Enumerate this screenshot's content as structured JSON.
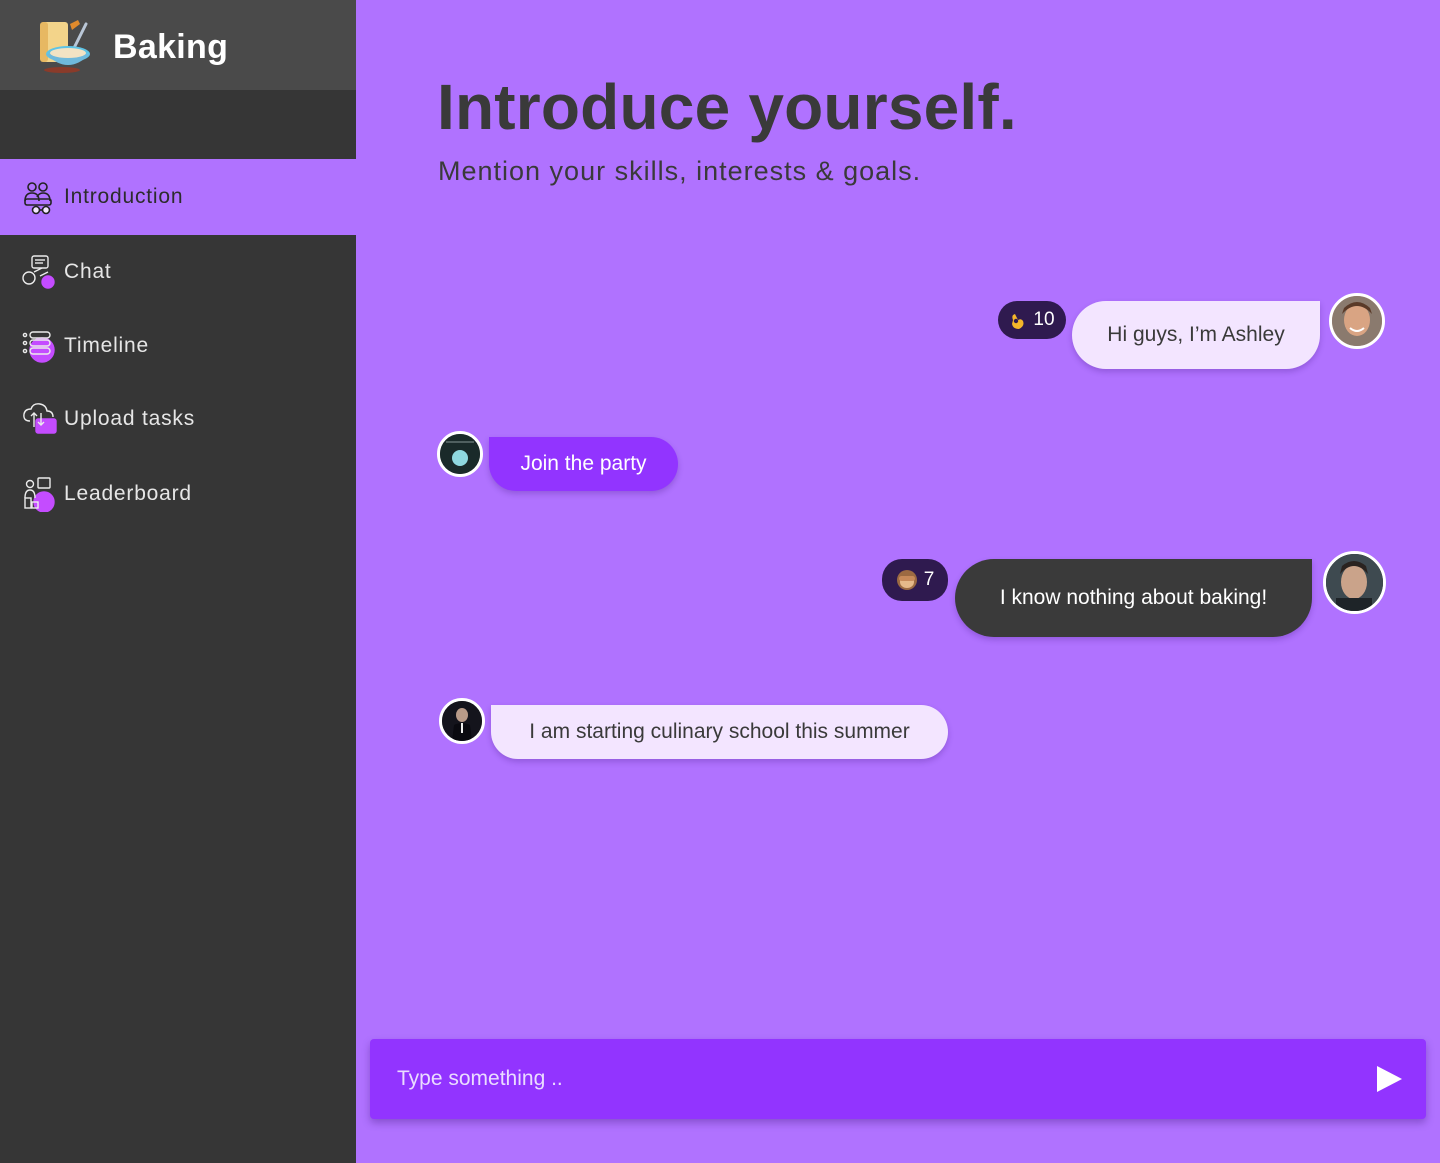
{
  "app": {
    "name": "Baking"
  },
  "sidebar": {
    "items": [
      {
        "label": "Introduction",
        "icon": "people-icon",
        "active": true
      },
      {
        "label": "Chat",
        "icon": "chat-icon",
        "active": false
      },
      {
        "label": "Timeline",
        "icon": "timeline-icon",
        "active": false
      },
      {
        "label": "Upload tasks",
        "icon": "upload-icon",
        "active": false
      },
      {
        "label": "Leaderboard",
        "icon": "leaderboard-icon",
        "active": false
      }
    ]
  },
  "header": {
    "title": "Introduce yourself.",
    "subtitle": "Mention your skills, interests & goals."
  },
  "messages": [
    {
      "text": "Hi guys, I’m Ashley",
      "side": "right",
      "style": "light",
      "reaction": {
        "emoji": "ok-hand-emoji",
        "count": "10"
      }
    },
    {
      "text": "Join the party",
      "side": "left",
      "style": "purple"
    },
    {
      "text": "I know nothing about baking!",
      "side": "right",
      "style": "dark",
      "reaction": {
        "emoji": "see-no-evil-monkey-emoji",
        "count": "7"
      }
    },
    {
      "text": "I am starting culinary school this summer",
      "side": "left",
      "style": "light"
    }
  ],
  "composer": {
    "placeholder": "Type something .."
  },
  "colors": {
    "background": "#b072ff",
    "sidebar": "#363636",
    "brand_bar": "#4a4a4a",
    "bubble_light": "#f3e5ff",
    "bubble_purple": "#9234ff",
    "bubble_dark": "#3a3a3a",
    "reaction_badge": "#2f1a4f",
    "composer": "#9234ff"
  }
}
